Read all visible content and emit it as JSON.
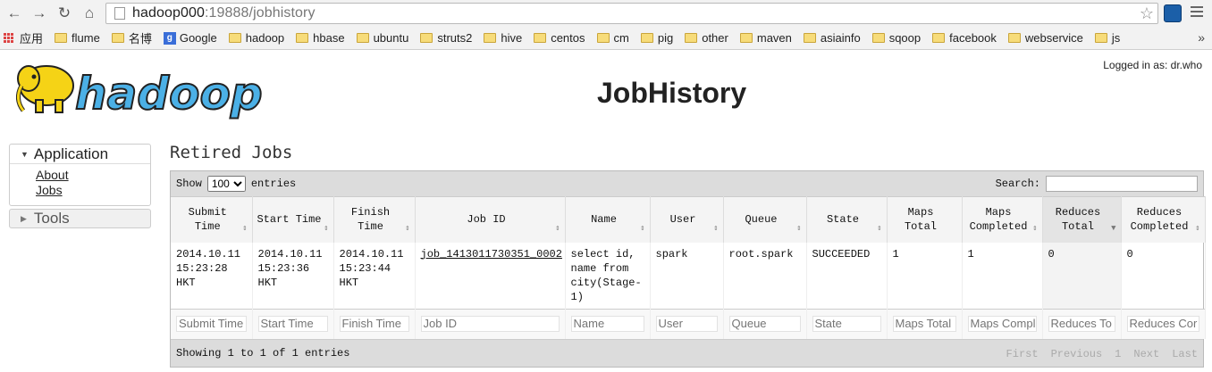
{
  "browser": {
    "url_host": "hadoop000",
    "url_rest": ":19888/jobhistory",
    "bookmarks": [
      "应用",
      "flume",
      "名博",
      "Google",
      "hadoop",
      "hbase",
      "ubuntu",
      "struts2",
      "hive",
      "centos",
      "cm",
      "pig",
      "other",
      "maven",
      "asiainfo",
      "sqoop",
      "facebook",
      "webservice",
      "js"
    ],
    "more": "»"
  },
  "header": {
    "logged_in": "Logged in as: dr.who",
    "title": "JobHistory",
    "logo_text": "hadoop"
  },
  "sidebar": {
    "application": "Application",
    "links": [
      "About",
      "Jobs"
    ],
    "tools": "Tools"
  },
  "main": {
    "section_title": "Retired Jobs",
    "show_label": "Show",
    "show_value": "100",
    "entries_label": "entries",
    "search_label": "Search:",
    "columns": [
      "Submit\nTime",
      "Start Time",
      "Finish\nTime",
      "Job ID",
      "Name",
      "User",
      "Queue",
      "State",
      "Maps\nTotal",
      "Maps\nCompleted",
      "Reduces\nTotal",
      "Reduces\nCompleted"
    ],
    "rows": [
      [
        "2014.10.11 15:23:28 HKT",
        "2014.10.11 15:23:36 HKT",
        "2014.10.11 15:23:44 HKT",
        "job_1413011730351_0002",
        "select id, name from city(Stage-1)",
        "spark",
        "root.spark",
        "SUCCEEDED",
        "1",
        "1",
        "0",
        "0"
      ]
    ],
    "filters": [
      "Submit Time",
      "Start Time",
      "Finish Time",
      "Job ID",
      "Name",
      "User",
      "Queue",
      "State",
      "Maps Total",
      "Maps Compl",
      "Reduces To",
      "Reduces Cor"
    ],
    "showing": "Showing 1 to 1 of 1 entries",
    "pager": [
      "First",
      "Previous",
      "1",
      "Next",
      "Last"
    ]
  },
  "colors": {
    "logo_yellow": "#f5d316",
    "logo_blue": "#4bb0e6"
  }
}
